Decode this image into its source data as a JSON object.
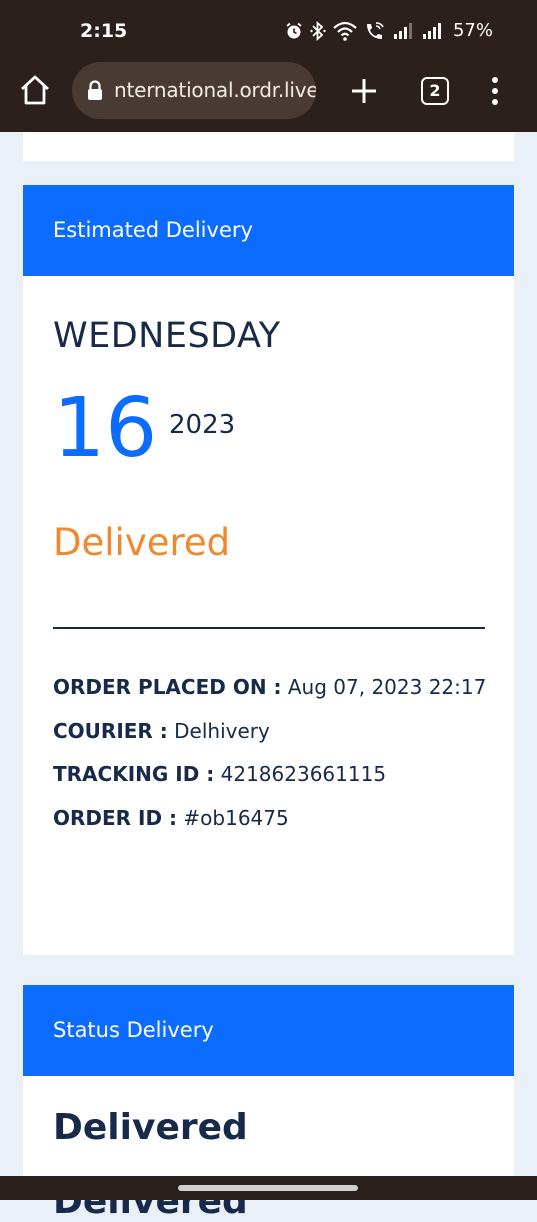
{
  "status_bar": {
    "time": "2:15",
    "battery": "57%",
    "icons": [
      "alarm-icon",
      "bluetooth-icon",
      "wifi-icon",
      "wifi-calling-icon",
      "signal-icon",
      "signal-icon"
    ]
  },
  "browser": {
    "url": "nternational.ordr.live",
    "tab_count": "2",
    "icons": [
      "home-icon",
      "lock-icon",
      "plus-icon",
      "more-vert-icon"
    ]
  },
  "estimated_delivery": {
    "header": "Estimated Delivery",
    "weekday": "WEDNESDAY",
    "day": "16",
    "year": "2023",
    "status": "Delivered",
    "status_color": "#f0892e",
    "details": [
      {
        "label": "ORDER PLACED ON :",
        "value": "Aug 07, 2023 22:17"
      },
      {
        "label": "COURIER :",
        "value": "Delhivery"
      },
      {
        "label": "TRACKING ID :",
        "value": "4218623661115"
      },
      {
        "label": "ORDER ID :",
        "value": "#ob16475"
      }
    ]
  },
  "status_delivery": {
    "header": "Status Delivery",
    "title": "Delivered",
    "title_2": "Delivered"
  },
  "colors": {
    "accent": "#0b6cff",
    "text_dark": "#172a4a",
    "page_bg": "#eaf0f7",
    "chrome_bg": "#2b201c"
  }
}
